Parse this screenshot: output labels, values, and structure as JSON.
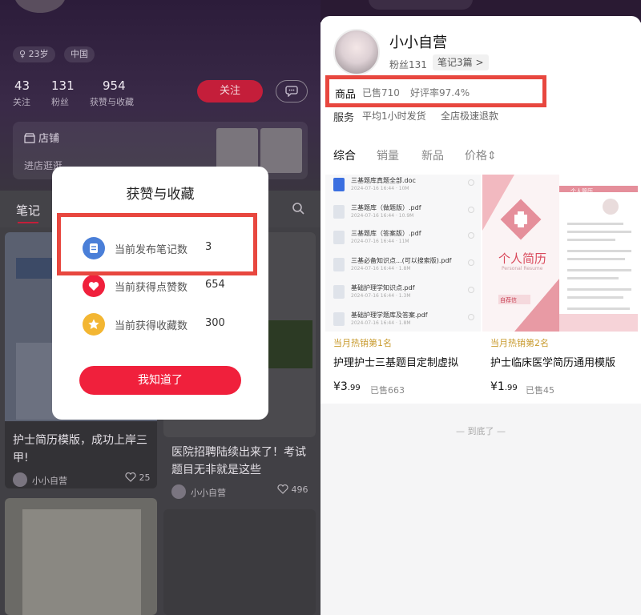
{
  "left": {
    "tags": [
      "23岁",
      "中国"
    ],
    "stats": [
      {
        "value": "43",
        "label": "关注"
      },
      {
        "value": "131",
        "label": "粉丝"
      },
      {
        "value": "954",
        "label": "获赞与收藏"
      }
    ],
    "follow_label": "关注",
    "store_title": "店铺",
    "store_sub": "进店逛逛",
    "notes_tab": "笔记",
    "notes": [
      {
        "title": "护士简历模版，成功上岸三甲!",
        "author": "小小自营",
        "likes": "25"
      },
      {
        "title": "医院招聘陆续出来了！考试题目无非就是这些",
        "author": "小小自营",
        "likes": "496"
      }
    ],
    "modal": {
      "title": "获赞与收藏",
      "rows": [
        {
          "label": "当前发布笔记数",
          "value": "3",
          "icon": "note-icon",
          "color": "#4a7fd8"
        },
        {
          "label": "当前获得点赞数",
          "value": "654",
          "icon": "heart-icon",
          "color": "#f0203c"
        },
        {
          "label": "当前获得收藏数",
          "value": "300",
          "icon": "star-icon",
          "color": "#f3b632"
        }
      ],
      "ok_label": "我知道了"
    }
  },
  "right": {
    "shop_name": "小小自营",
    "fans": "粉丝131",
    "notes_count": "笔记3篇 >",
    "goods_label": "商品",
    "sold": "已售710",
    "rating": "好评率97.4%",
    "service_label": "服务",
    "service_a": "平均1小时发货",
    "service_b": "全店极速退款",
    "tabs": [
      "综合",
      "销量",
      "新品",
      "价格⇕"
    ],
    "files": [
      {
        "name": "三基题库真题全部.doc",
        "meta": "2024-07-16 16:44 · 10M"
      },
      {
        "name": "三基题库（做题版）.pdf",
        "meta": "2024-07-16 16:44 · 10.9M"
      },
      {
        "name": "三基题库（答案版）.pdf",
        "meta": "2024-07-16 16:44 · 11M"
      },
      {
        "name": "三基必备知识点...(可以搜索版).pdf",
        "meta": "2024-07-16 16:44 · 1.8M"
      },
      {
        "name": "基础护理学知识点.pdf",
        "meta": "2024-07-16 16:44 · 1.3M"
      },
      {
        "name": "基础护理学题库及答案.pdf",
        "meta": "2024-07-16 16:44 · 1.8M"
      }
    ],
    "products": [
      {
        "rank": "当月热销第1名",
        "title": "护理护士三基题目定制虚拟",
        "price_main": "¥3",
        "price_dec": ".99",
        "sold": "已售663"
      },
      {
        "rank": "当月热销第2名",
        "title": "护士临床医学简历通用模版",
        "price_main": "¥1",
        "price_dec": ".99",
        "sold": "已售45"
      }
    ],
    "resume_cover": {
      "title": "个人简历",
      "subtitle": "Personal Resume",
      "small_title": "个人简历",
      "footer": "自荐信"
    },
    "end_text": "— 到底了 —"
  }
}
